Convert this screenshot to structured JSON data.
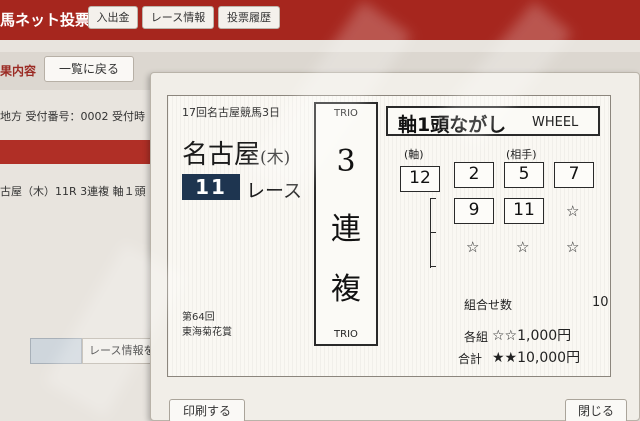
{
  "header": {
    "brand": "馬ネット投票",
    "nav": [
      {
        "label": "入出金"
      },
      {
        "label": "レース情報"
      },
      {
        "label": "投票履歴"
      }
    ]
  },
  "background": {
    "section_label": "果内容",
    "back_button": "一覧に戻る",
    "receipt_info": "地方  受付番号：0002  受付時",
    "race_line": "古屋（木）11R  3連複  軸１頭",
    "race_info_button": "レース情報を見"
  },
  "ticket": {
    "race_title": "17回名古屋競馬3日",
    "venue": "名古屋",
    "weekday": "(木)",
    "race_number": "11",
    "race_label": "レース",
    "race_count": "第64回",
    "race_name": "東海菊花賞",
    "bet_type": {
      "en_top": "TRIO",
      "chars": [
        "3",
        "連",
        "複"
      ],
      "en_bottom": "TRIO"
    },
    "method_jp": "軸1頭ながし",
    "method_en": "WHEEL",
    "axis_header": "(軸)",
    "partner_header": "(相手)",
    "axis_horse": "12",
    "partners": [
      "2",
      "5",
      "7",
      "9",
      "11"
    ],
    "star": "☆",
    "combo_label": "組合せ数",
    "combo_count": "10",
    "each_label": "各組",
    "each_value": "☆☆1,000円",
    "total_label": "合計",
    "total_value": "★★10,000円"
  },
  "footer": {
    "print_button": "印刷する",
    "close_button": "閉じる"
  }
}
